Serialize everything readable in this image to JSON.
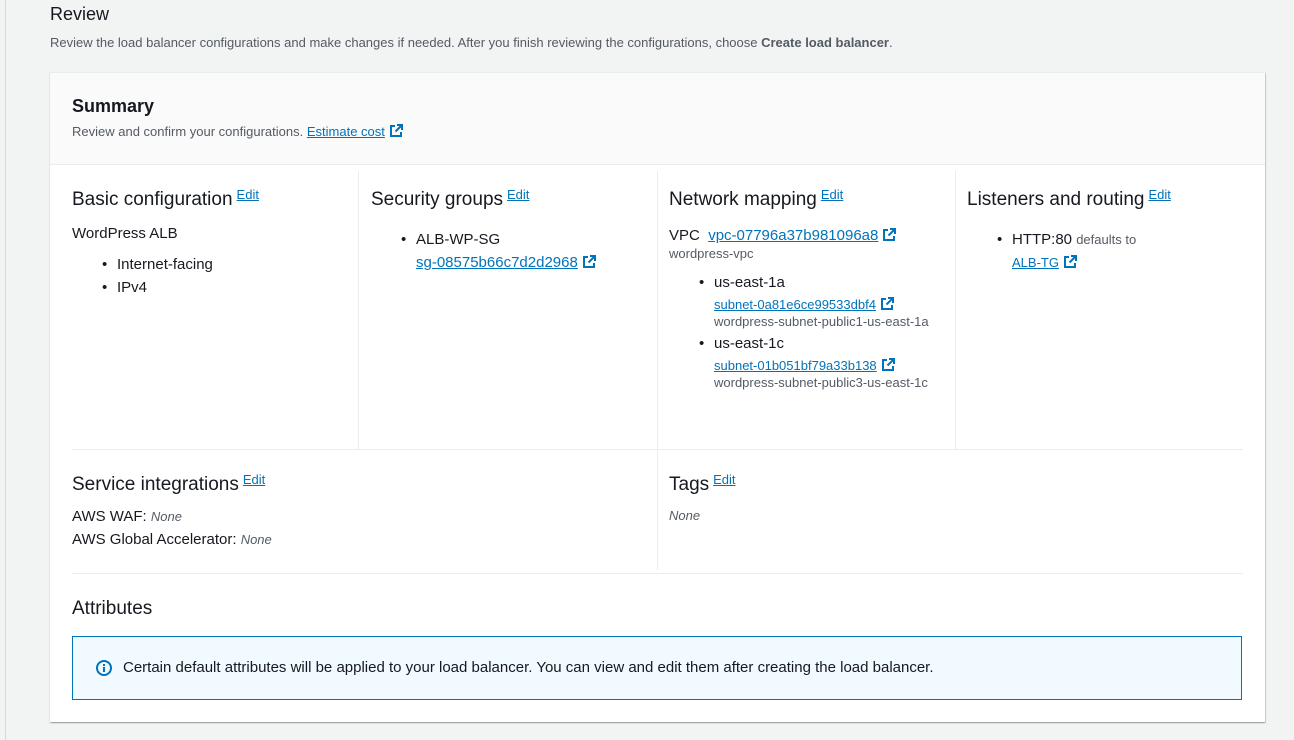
{
  "review": {
    "title": "Review",
    "description_prefix": "Review the load balancer configurations and make changes if needed. After you finish reviewing the configurations, choose ",
    "description_bold": "Create load balancer",
    "description_suffix": "."
  },
  "summary": {
    "title": "Summary",
    "description": "Review and confirm your configurations.",
    "estimate_cost_link": "Estimate cost"
  },
  "edit_label": "Edit",
  "basic_configuration": {
    "title": "Basic configuration",
    "name": "WordPress ALB",
    "items": [
      "Internet-facing",
      "IPv4"
    ]
  },
  "security_groups": {
    "title": "Security groups",
    "group_name": "ALB-WP-SG",
    "group_id": "sg-08575b66c7d2d2968"
  },
  "network_mapping": {
    "title": "Network mapping",
    "vpc_label": "VPC",
    "vpc_id": "vpc-07796a37b981096a8",
    "vpc_name": "wordpress-vpc",
    "zones": [
      {
        "az": "us-east-1a",
        "subnet_id": "subnet-0a81e6ce99533dbf4",
        "subnet_name": "wordpress-subnet-public1-us-east-1a"
      },
      {
        "az": "us-east-1c",
        "subnet_id": "subnet-01b051bf79a33b138",
        "subnet_name": "wordpress-subnet-public3-us-east-1c"
      }
    ]
  },
  "listeners": {
    "title": "Listeners and routing",
    "listener": "HTTP:80",
    "defaults_to": "defaults to",
    "target_group": "ALB-TG"
  },
  "service_integrations": {
    "title": "Service integrations",
    "waf_label": "AWS WAF:",
    "waf_value": "None",
    "ga_label": "AWS Global Accelerator:",
    "ga_value": "None"
  },
  "tags": {
    "title": "Tags",
    "value": "None"
  },
  "attributes": {
    "title": "Attributes",
    "info": "Certain default attributes will be applied to your load balancer. You can view and edit them after creating the load balancer."
  },
  "colors": {
    "link": "#0073bb",
    "info_border": "#0073bb",
    "info_bg": "#f1faff",
    "page_bg": "#f2f3f3"
  }
}
